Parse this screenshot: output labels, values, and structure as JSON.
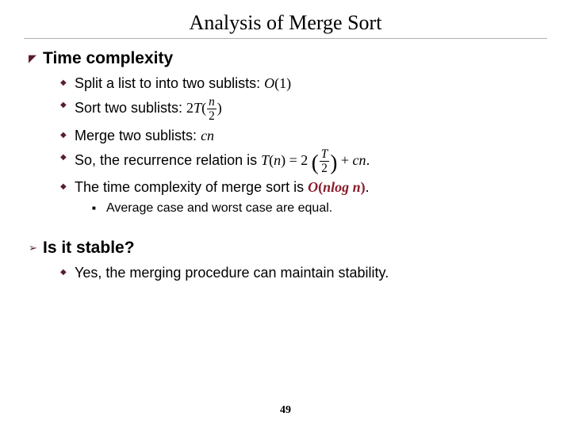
{
  "title": "Analysis of Merge Sort",
  "sections": [
    {
      "bullet": "◤",
      "heading": "Time complexity",
      "items": [
        {
          "bullet": "◆",
          "text_html": "Split a list to into two sublists: <span class='math'>O<span class='up'>(1)</span></span>"
        },
        {
          "bullet": "◆",
          "text_html": "Sort two sublists: <span class='math'><span class='up'>2</span>T<span class='up'>(</span><span class='frac'><span class='num'>n</span><span class='den up'>2</span></span><span class='up'>)</span></span>"
        },
        {
          "bullet": "◆",
          "text_html": "Merge two sublists: <span class='math'>cn</span>"
        },
        {
          "bullet": "◆",
          "text_html": "So, the recurrence relation is <span class='math'>T<span class='up'>(</span>n<span class='up'>)</span> <span class='up'>= 2</span> <span class='bigp'>(</span><span class='frac'><span class='num'>T</span><span class='den up'>2</span></span><span class='bigp'>)</span> <span class='up'>+</span> cn</span>."
        },
        {
          "bullet": "◆",
          "text_html": "The time complexity of merge sort is <span class='math hl'>O<span class='up'>(</span>nlog n<span class='up'>)</span></span>.",
          "subitems": [
            {
              "bullet": "■",
              "text_html": "Average case and worst case are equal."
            }
          ]
        }
      ]
    },
    {
      "bullet": "➢",
      "heading": "Is it stable?",
      "items": [
        {
          "bullet": "◆",
          "text_html": "Yes, the merging procedure can maintain stability."
        }
      ]
    }
  ],
  "page_number": "49"
}
